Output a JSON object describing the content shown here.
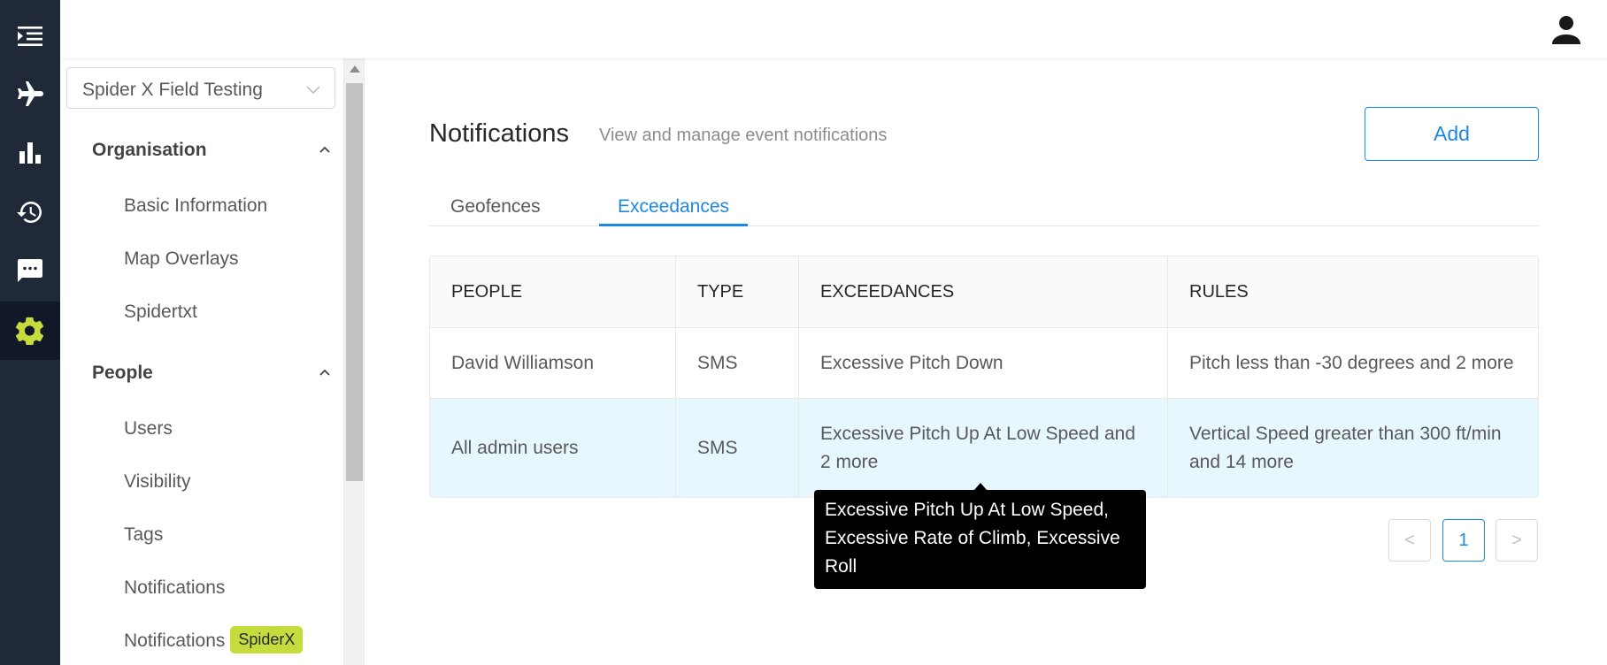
{
  "rail": {
    "icons": [
      "menu-expand-icon",
      "airplane-icon",
      "bar-chart-icon",
      "history-icon",
      "message-icon",
      "gear-icon"
    ],
    "accent": "#c6dc3c"
  },
  "sidebar": {
    "org_select": "Spider X Field Testing",
    "groups": [
      {
        "title": "Organisation",
        "items": [
          "Basic Information",
          "Map Overlays",
          "Spidertxt"
        ]
      },
      {
        "title": "People",
        "items": [
          "Users",
          "Visibility",
          "Tags",
          "Notifications",
          "Notifications"
        ]
      }
    ],
    "badge": "SpiderX"
  },
  "page": {
    "title": "Notifications",
    "subtitle": "View and manage event notifications",
    "add_label": "Add"
  },
  "tabs": [
    {
      "label": "Geofences",
      "active": false
    },
    {
      "label": "Exceedances",
      "active": true
    }
  ],
  "table": {
    "headers": [
      "PEOPLE",
      "TYPE",
      "EXCEEDANCES",
      "RULES"
    ],
    "rows": [
      [
        "David Williamson",
        "SMS",
        "Excessive Pitch Down",
        "Pitch less than -30 degrees and 2 more"
      ],
      [
        "All admin users",
        "SMS",
        "Excessive Pitch Up At Low Speed and 2 more",
        "Vertical Speed greater than 300 ft/min and 14 more"
      ]
    ]
  },
  "tooltip": "Excessive Pitch Up At Low Speed, Excessive Rate of Climb, Excessive Roll",
  "pagination": {
    "prev": "<",
    "page": "1",
    "next": ">"
  },
  "colors": {
    "primary": "#1e88e5",
    "rail_bg": "#1f2937",
    "row_highlight": "#e6f7fe"
  }
}
